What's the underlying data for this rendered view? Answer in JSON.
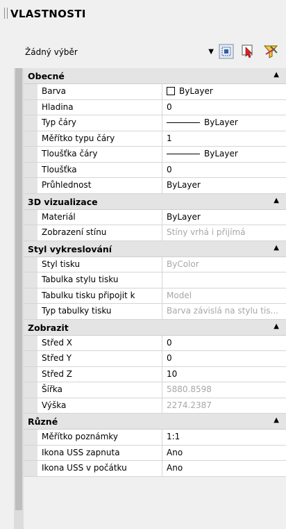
{
  "panel": {
    "title": "VLASTNOSTI"
  },
  "selector": {
    "value": "Žádný výběr"
  },
  "toolbar": [
    {
      "name": "quick-select-icon"
    },
    {
      "name": "select-objects-icon"
    },
    {
      "name": "toggle-pickadd-icon"
    }
  ],
  "sections": [
    {
      "title": "Obecné",
      "rows": [
        {
          "label": "Barva",
          "value": "ByLayer",
          "kind": "color"
        },
        {
          "label": "Hladina",
          "value": "0"
        },
        {
          "label": "Typ čáry",
          "value": "ByLayer",
          "kind": "line"
        },
        {
          "label": "Měřítko typu čáry",
          "value": "1"
        },
        {
          "label": "Tloušťka čáry",
          "value": "ByLayer",
          "kind": "line"
        },
        {
          "label": "Tloušťka",
          "value": "0"
        },
        {
          "label": "Průhlednost",
          "value": "ByLayer"
        }
      ]
    },
    {
      "title": "3D vizualizace",
      "rows": [
        {
          "label": "Materiál",
          "value": "ByLayer"
        },
        {
          "label": "Zobrazení stínu",
          "value": "Stíny vrhá i přijímá",
          "disabled": true
        }
      ]
    },
    {
      "title": "Styl vykreslování",
      "rows": [
        {
          "label": "Styl tisku",
          "value": "ByColor",
          "disabled": true
        },
        {
          "label": "Tabulka stylu tisku",
          "value": ""
        },
        {
          "label": "Tabulku tisku připojit k",
          "value": "Model",
          "disabled": true
        },
        {
          "label": "Typ tabulky tisku",
          "value": "Barva závislá na stylu tis...",
          "disabled": true
        }
      ]
    },
    {
      "title": "Zobrazit",
      "rows": [
        {
          "label": "Střed X",
          "value": "0"
        },
        {
          "label": "Střed Y",
          "value": "0"
        },
        {
          "label": "Střed Z",
          "value": "10"
        },
        {
          "label": "Šířka",
          "value": "5880.8598",
          "disabled": true
        },
        {
          "label": "Výška",
          "value": "2274.2387",
          "disabled": true
        }
      ]
    },
    {
      "title": "Různé",
      "rows": [
        {
          "label": "Měřítko poznámky",
          "value": "1:1"
        },
        {
          "label": "Ikona USS zapnuta",
          "value": "Ano"
        },
        {
          "label": "Ikona USS v počátku",
          "value": "Ano"
        }
      ]
    }
  ],
  "colors": {
    "section_bg": "#e4e4e4",
    "disabled_text": "#a7a7a7",
    "panel_bg": "#f0f0f0"
  }
}
